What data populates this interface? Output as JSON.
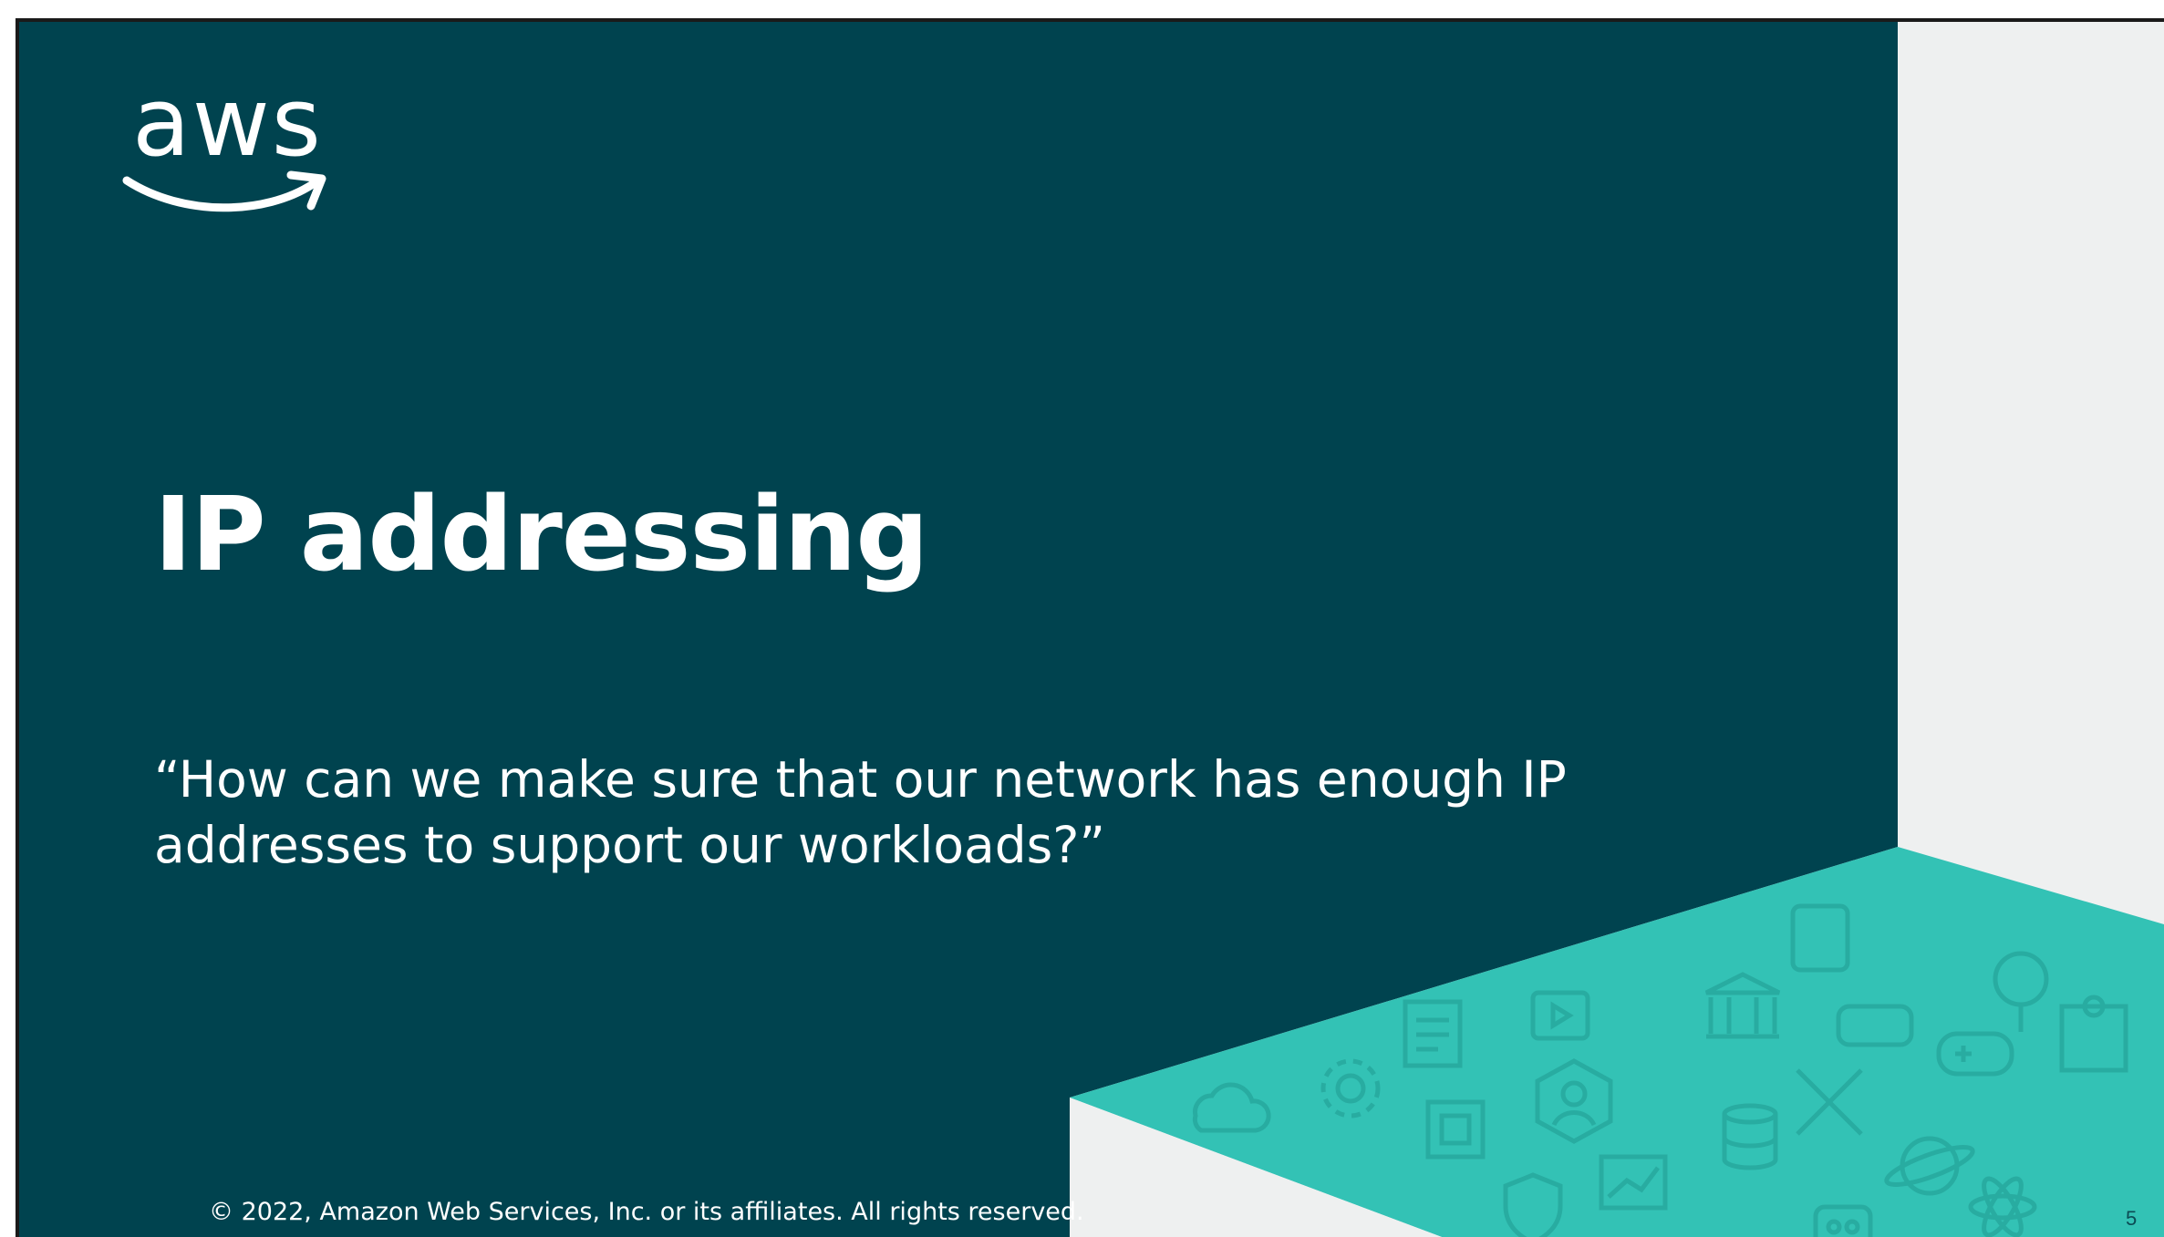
{
  "slide": {
    "logo_text": "aws",
    "title": "IP addressing",
    "quote": "“How can we make sure that our network has enough IP addresses to support our workloads?”",
    "copyright": "© 2022, Amazon Web Services, Inc. or its affiliates. All rights reserved.",
    "page_number": "5"
  },
  "colors": {
    "panel": "#00434f",
    "teal": "#33c2b5",
    "light": "#eef0f0",
    "text": "#ffffff"
  },
  "decor_icons": [
    "cloud-icon",
    "gear-icon",
    "chip-icon",
    "shield-icon",
    "user-icon",
    "chart-icon",
    "database-icon",
    "tools-icon",
    "gamepad-icon",
    "globe-icon",
    "puzzle-icon",
    "bank-icon",
    "video-icon",
    "vr-headset-icon",
    "device-icon",
    "robot-icon",
    "atom-icon",
    "tree-icon"
  ]
}
